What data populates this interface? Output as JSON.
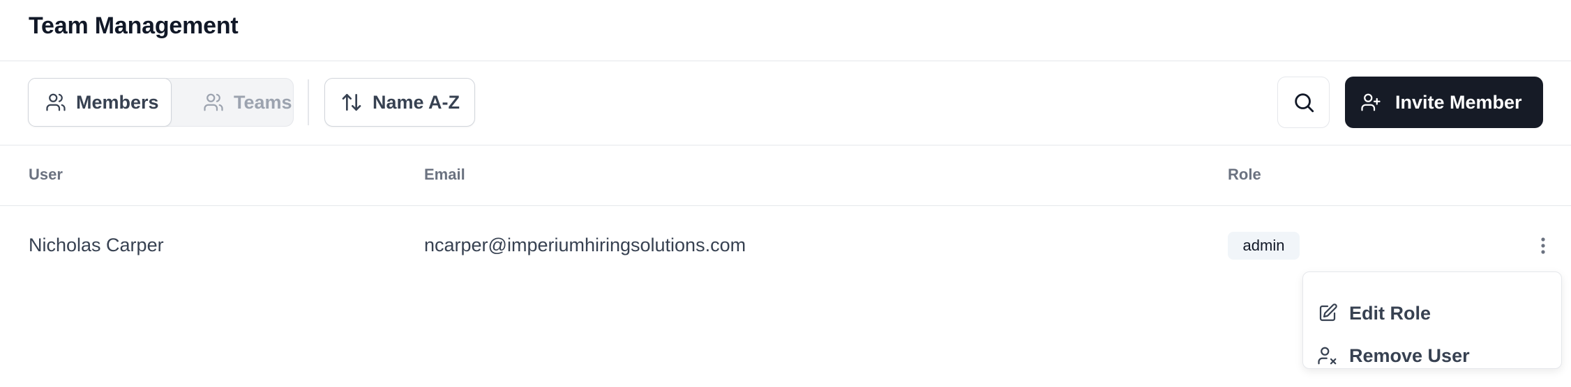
{
  "header": {
    "title": "Team Management"
  },
  "toolbar": {
    "view_tabs": [
      {
        "label": "Members",
        "icon": "users-icon",
        "active": true
      },
      {
        "label": "Teams",
        "icon": "users-icon",
        "active": false
      }
    ],
    "sort_label": "Name A-Z",
    "search_icon": "search-icon",
    "invite_label": "Invite Member"
  },
  "table": {
    "columns": [
      "User",
      "Email",
      "Role"
    ],
    "rows": [
      {
        "user": "Nicholas Carper",
        "email": "ncarper@imperiumhiringsolutions.com",
        "role": "admin"
      }
    ]
  },
  "row_menu": {
    "items": [
      {
        "label": "Edit Role",
        "icon": "edit-icon"
      },
      {
        "label": "Remove User",
        "icon": "user-remove-icon"
      }
    ]
  },
  "colors": {
    "primary": "#161b26",
    "muted_text": "#6b7280",
    "border": "#e5e7eb",
    "badge_bg": "#f1f5f9"
  }
}
